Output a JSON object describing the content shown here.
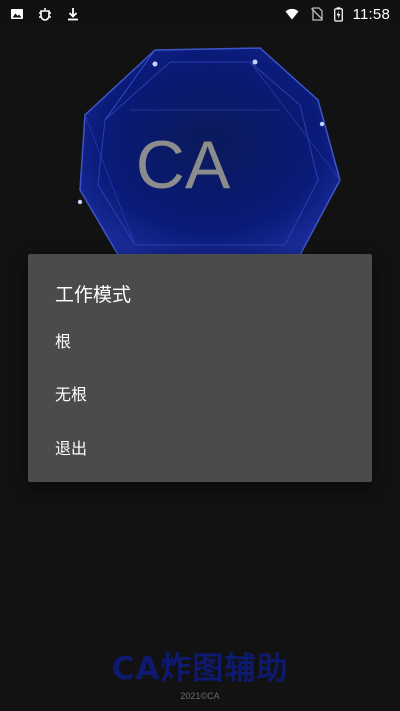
{
  "status_bar": {
    "time": "11:58",
    "icons_left": [
      "image-icon",
      "bug-icon",
      "download-icon"
    ],
    "icons_right": [
      "wifi-icon",
      "no-sim-icon",
      "battery-icon"
    ]
  },
  "logo": {
    "text": "CA",
    "color": "#0a1a6e"
  },
  "dialog": {
    "title": "工作模式",
    "items": [
      {
        "label": "根"
      },
      {
        "label": "无根"
      },
      {
        "label": "退出"
      }
    ],
    "background": "#4b4b4b"
  },
  "footer": {
    "brand": "CA炸图辅助",
    "copyright": "2021©CA",
    "brand_color": "#0d1a6e"
  }
}
